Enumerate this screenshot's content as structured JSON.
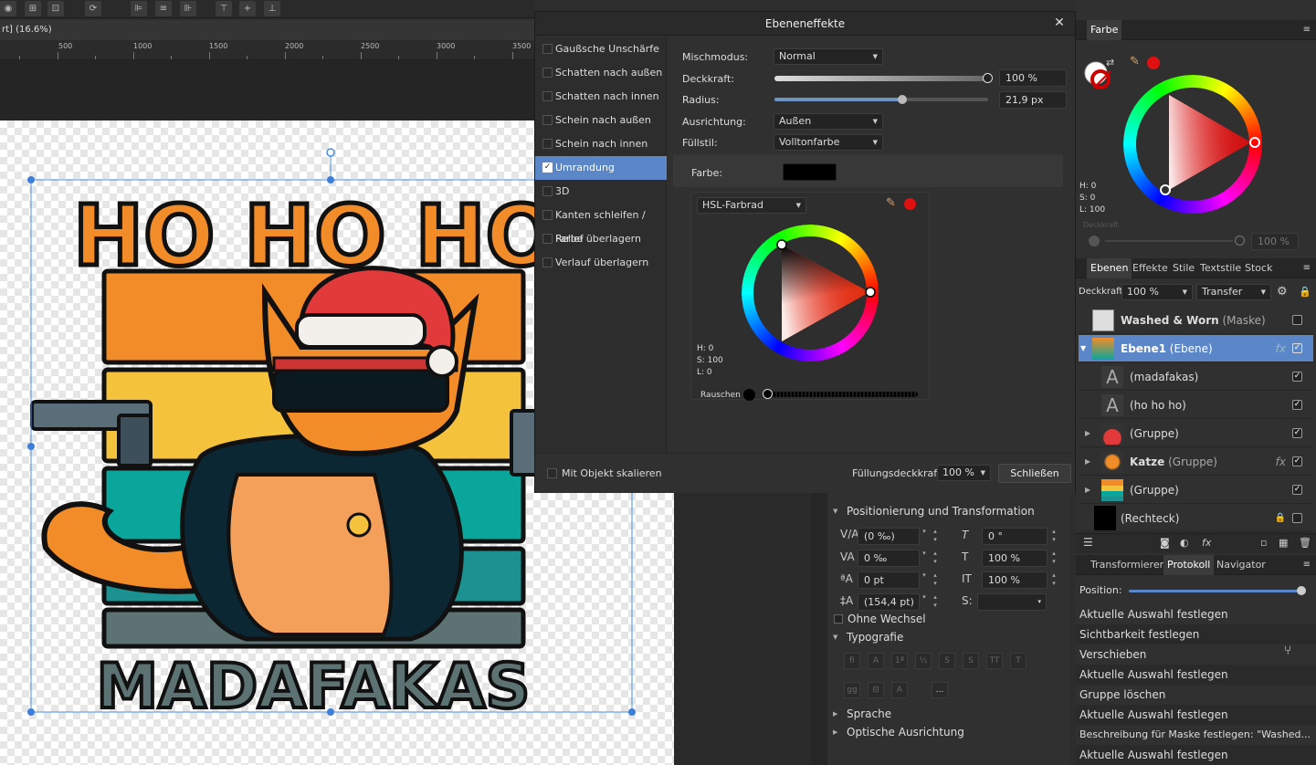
{
  "canvas_tab": {
    "label": "rt] (16.6%)"
  },
  "ruler": {
    "marks": [
      "500",
      "1000",
      "1500",
      "2000",
      "2500",
      "3000",
      "3500"
    ]
  },
  "artwork": {
    "top_text": "HO HO HO",
    "bottom_text": "MADAFAKAS",
    "colors": {
      "orange": "#f28c28",
      "yellow": "#f4c23b",
      "teal": "#0aa69b",
      "dark_teal": "#1c9191",
      "slate": "#5d7373"
    }
  },
  "dialog": {
    "title": "Ebeneneffekte",
    "effects": [
      {
        "label": "Gaußsche Unschärfe",
        "checked": false
      },
      {
        "label": "Schatten nach außen",
        "checked": false
      },
      {
        "label": "Schatten nach innen",
        "checked": false
      },
      {
        "label": "Schein nach außen",
        "checked": false
      },
      {
        "label": "Schein nach innen",
        "checked": false
      },
      {
        "label": "Umrandung",
        "checked": true
      },
      {
        "label": "3D",
        "checked": false
      },
      {
        "label": "Kanten schleifen / Relief",
        "checked": false
      },
      {
        "label": "Farbe überlagern",
        "checked": false
      },
      {
        "label": "Verlauf überlagern",
        "checked": false
      }
    ],
    "mischmodus": {
      "label": "Mischmodus:",
      "value": "Normal"
    },
    "deckkraft": {
      "label": "Deckkraft:",
      "value": "100 %",
      "level": 1.0
    },
    "radius": {
      "label": "Radius:",
      "value": "21,9 px",
      "level": 0.6
    },
    "ausrichtung": {
      "label": "Ausrichtung:",
      "value": "Außen"
    },
    "fuellstil": {
      "label": "Füllstil:",
      "value": "Volltonfarbe"
    },
    "farbe": {
      "label": "Farbe:",
      "swatch": "#000000"
    },
    "picker": {
      "mode": "HSL-Farbrad",
      "h": "H: 0",
      "s": "S: 100",
      "l": "L: 0",
      "noise_label": "Rauschen"
    },
    "mit_objekt": "Mit Objekt skalieren",
    "fuellungsdeckkraft_label": "Füllungsdeckkraft:",
    "fuellungsdeckkraft_value": "100 %",
    "schliessen": "Schließen"
  },
  "color_panel": {
    "tab": "Farbe",
    "h": "H: 0",
    "s": "S: 0",
    "l": "L: 100",
    "opacity_label": "Deckkraft",
    "opacity_value": "100 %"
  },
  "layers_panel": {
    "tabs": [
      "Ebenen",
      "Effekte",
      "Stile",
      "Textstile",
      "Stock"
    ],
    "deckkraft_label": "Deckkraft:",
    "deckkraft_value": "100 %",
    "blend": "Transfer",
    "layers": [
      {
        "name": "Washed & Worn",
        "type": "(Maske)"
      },
      {
        "name": "Ebene1",
        "type": "(Ebene)"
      },
      {
        "name": "",
        "type": "(madafakas)"
      },
      {
        "name": "",
        "type": "(ho ho ho)"
      },
      {
        "name": "",
        "type": "(Gruppe)"
      },
      {
        "name": "Katze",
        "type": "(Gruppe)"
      },
      {
        "name": "",
        "type": "(Gruppe)"
      },
      {
        "name": "",
        "type": "(Rechteck)"
      }
    ]
  },
  "history_panel": {
    "tabs": [
      "Transformieren",
      "Protokoll",
      "Navigator"
    ],
    "position_label": "Position:",
    "items": [
      "Aktuelle Auswahl festlegen",
      "Sichtbarkeit festlegen",
      "Verschieben",
      "Aktuelle Auswahl festlegen",
      "Gruppe löschen",
      "Aktuelle Auswahl festlegen",
      "Beschreibung für Maske festlegen: \"Washed...",
      "Aktuelle Auswahl festlegen"
    ]
  },
  "context_panel": {
    "section_pos": "Positionierung und Transformation",
    "tracking": "(0 ‰)",
    "kerning": "0 ‰",
    "baseline": "0 pt",
    "leading": "(154,4 pt)",
    "rotation": "0 °",
    "hscale": "100 %",
    "vscale": "100 %",
    "no_alternate": "Ohne Wechsel",
    "section_typo": "Typografie",
    "section_sprache": "Sprache",
    "section_optisch": "Optische Ausrichtung",
    "more": "..."
  }
}
